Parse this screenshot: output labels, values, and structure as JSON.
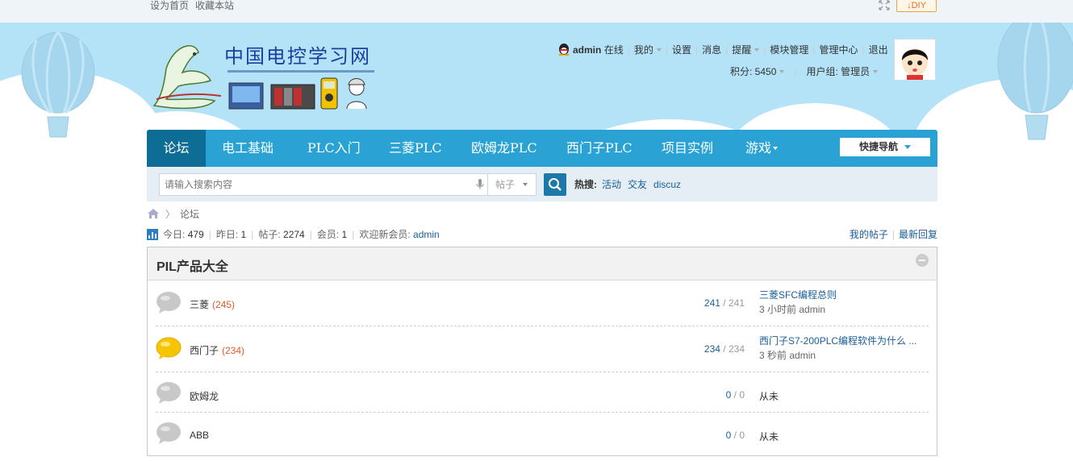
{
  "topbar": {
    "set_home": "设为首页",
    "bookmark": "收藏本站",
    "diy_label": "DIY"
  },
  "logo": {
    "site_name": "中国电控学习网"
  },
  "user": {
    "name": "admin",
    "status": "在线",
    "menu": [
      "我的",
      "设置",
      "消息",
      "提醒",
      "模块管理",
      "管理中心",
      "退出"
    ],
    "points_label": "积分: 5450",
    "group_label": "用户组: 管理员"
  },
  "nav": {
    "items": [
      "论坛",
      "电工基础",
      "PLC入门",
      "三菱PLC",
      "欧姆龙PLC",
      "西门子PLC",
      "项目实例",
      "游戏"
    ],
    "quick_nav": "快捷导航"
  },
  "search": {
    "placeholder": "请输入搜索内容",
    "type": "帖子",
    "hot_label": "热搜:",
    "hot_items": [
      "活动",
      "交友",
      "discuz"
    ]
  },
  "breadcrumb": {
    "current": "论坛"
  },
  "stats": {
    "today_label": "今日:",
    "today": "479",
    "yesterday_label": "昨日:",
    "yesterday": "1",
    "posts_label": "帖子:",
    "posts": "2274",
    "members_label": "会员:",
    "members": "1",
    "newest_label": "欢迎新会员:",
    "newest": "admin",
    "my_posts": "我的帖子",
    "latest_replies": "最新回复"
  },
  "category": {
    "title": "PIL产品大全",
    "forums": [
      {
        "name": "三菱",
        "today": "(245)",
        "threads": "241",
        "posts": "241",
        "last_title": "三菱SFC编程总则",
        "last_time": "3 小时前",
        "last_user": "admin",
        "active": false
      },
      {
        "name": "西门子",
        "today": "(234)",
        "threads": "234",
        "posts": "234",
        "last_title": "西门子S7-200PLC编程软件为什么 ...",
        "last_time": "3 秒前",
        "last_user": "admin",
        "active": true
      },
      {
        "name": "欧姆龙",
        "today": "",
        "threads": "0",
        "posts": "0",
        "last_title": "从未",
        "active": false
      },
      {
        "name": "ABB",
        "today": "",
        "threads": "0",
        "posts": "0",
        "last_title": "从未",
        "active": false
      }
    ],
    "sep": "/"
  },
  "colors": {
    "nav_bg": "#2aa3d4",
    "nav_active": "#0d6d94",
    "sky": "#b4e2f6",
    "link": "#1a5e9a",
    "today_count": "#e05a2a"
  }
}
